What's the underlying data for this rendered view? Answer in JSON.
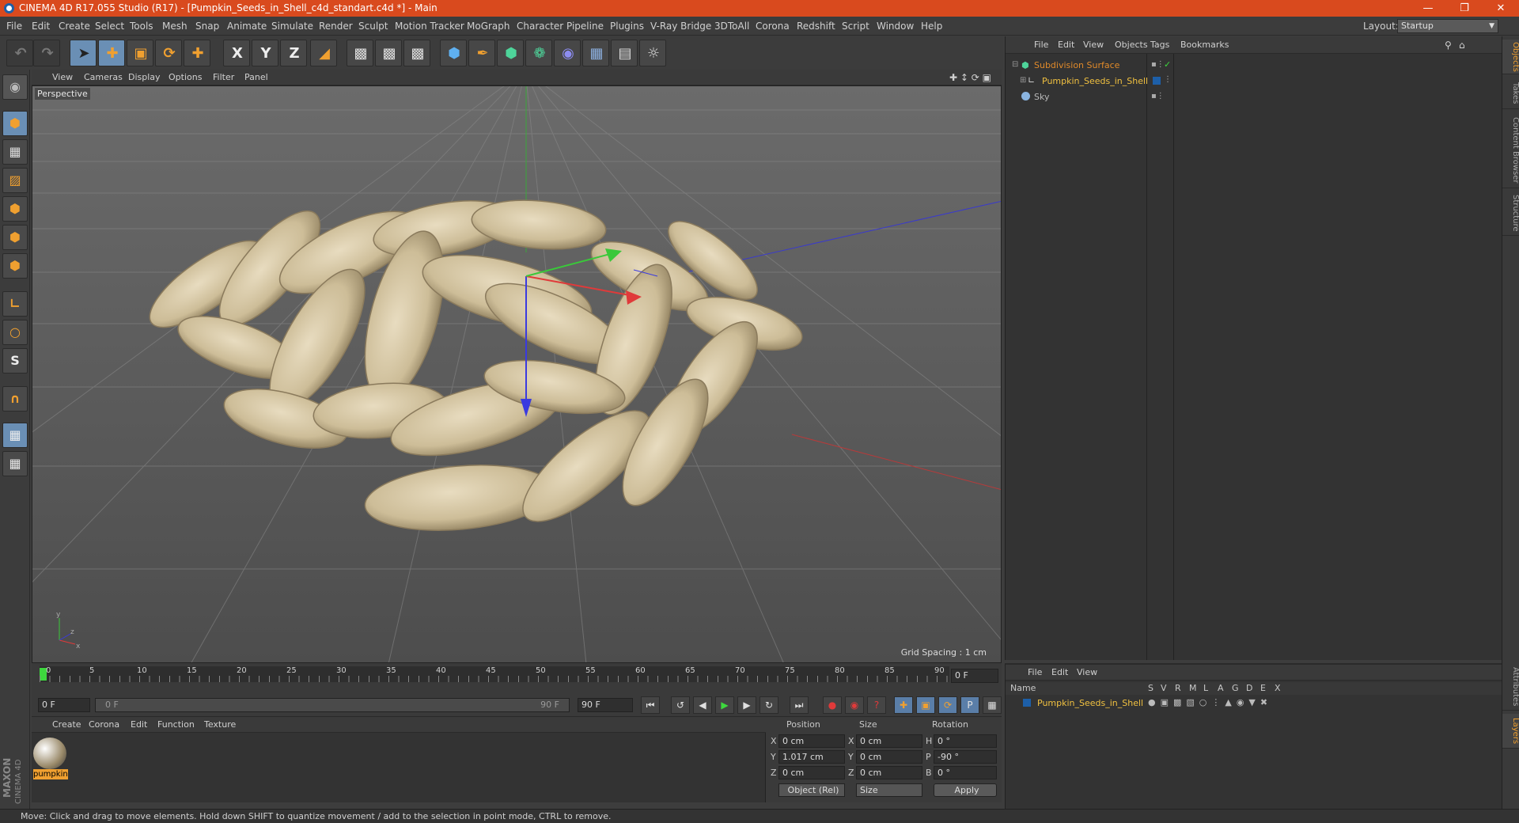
{
  "window": {
    "title": "CINEMA 4D R17.055 Studio (R17) - [Pumpkin_Seeds_in_Shell_c4d_standart.c4d *] - Main"
  },
  "menubar": {
    "items": [
      "File",
      "Edit",
      "Create",
      "Select",
      "Tools",
      "Mesh",
      "Snap",
      "Animate",
      "Simulate",
      "Render",
      "Sculpt",
      "Motion Tracker",
      "MoGraph",
      "Character",
      "Pipeline",
      "Plugins",
      "V-Ray Bridge",
      "3DToAll",
      "Corona",
      "Redshift",
      "Script",
      "Window",
      "Help"
    ],
    "layout_label": "Layout:",
    "layout_value": "Startup"
  },
  "toolbar": {
    "axis_x": "X",
    "axis_y": "Y",
    "axis_z": "Z"
  },
  "viewport": {
    "menu": [
      "View",
      "Cameras",
      "Display",
      "Options",
      "Filter",
      "Panel"
    ],
    "label": "Perspective",
    "grid_spacing": "Grid Spacing : 1 cm"
  },
  "timeline": {
    "ticks": [
      "0",
      "5",
      "10",
      "15",
      "20",
      "25",
      "30",
      "35",
      "40",
      "45",
      "50",
      "55",
      "60",
      "65",
      "70",
      "75",
      "80",
      "85",
      "90"
    ],
    "current_frame": "0 F",
    "start_field": "0 F",
    "range_start": "0 F",
    "range_end": "90 F",
    "end_field": "90 F"
  },
  "materials": {
    "menu": [
      "Create",
      "Corona",
      "Edit",
      "Function",
      "Texture"
    ],
    "items": [
      {
        "name": "pumpkin"
      }
    ],
    "brand_line1": "MAXON",
    "brand_line2": "CINEMA 4D"
  },
  "coords": {
    "headers": {
      "position": "Position",
      "size": "Size",
      "rotation": "Rotation"
    },
    "rows": [
      {
        "axis": "X",
        "pos": "0 cm",
        "size_axis": "X",
        "size": "0 cm",
        "rot_axis": "H",
        "rot": "0 °"
      },
      {
        "axis": "Y",
        "pos": "1.017 cm",
        "size_axis": "Y",
        "size": "0 cm",
        "rot_axis": "P",
        "rot": "-90 °"
      },
      {
        "axis": "Z",
        "pos": "0 cm",
        "size_axis": "Z",
        "size": "0 cm",
        "rot_axis": "B",
        "rot": "0 °"
      }
    ],
    "mode": "Object (Rel)",
    "size_mode": "Size",
    "apply": "Apply"
  },
  "objects": {
    "menu": [
      "File",
      "Edit",
      "View",
      "Objects",
      "Tags",
      "Bookmarks"
    ],
    "items": [
      {
        "name": "Subdivision Surface",
        "color": "#e08a2a"
      },
      {
        "name": "Pumpkin_Seeds_in_Shell",
        "color": "#f0c040"
      },
      {
        "name": "Sky",
        "color": "#b8b8b8"
      }
    ]
  },
  "layers": {
    "menu": [
      "File",
      "Edit",
      "View"
    ],
    "col_name": "Name",
    "cols": [
      "S",
      "V",
      "R",
      "M",
      "L",
      "A",
      "G",
      "D",
      "E",
      "X"
    ],
    "items": [
      {
        "name": "Pumpkin_Seeds_in_Shell"
      }
    ]
  },
  "right_tabs": [
    "Objects",
    "Takes",
    "Content Browser",
    "Structure"
  ],
  "right_tabs_bottom": [
    "Attributes",
    "Layers"
  ],
  "status": "Move: Click and drag to move elements. Hold down SHIFT to quantize movement / add to the selection in point mode, CTRL to remove.",
  "colors": {
    "titlebar": "#d94a1e",
    "accent": "#f0a030",
    "selected": "#6a8fb5"
  }
}
